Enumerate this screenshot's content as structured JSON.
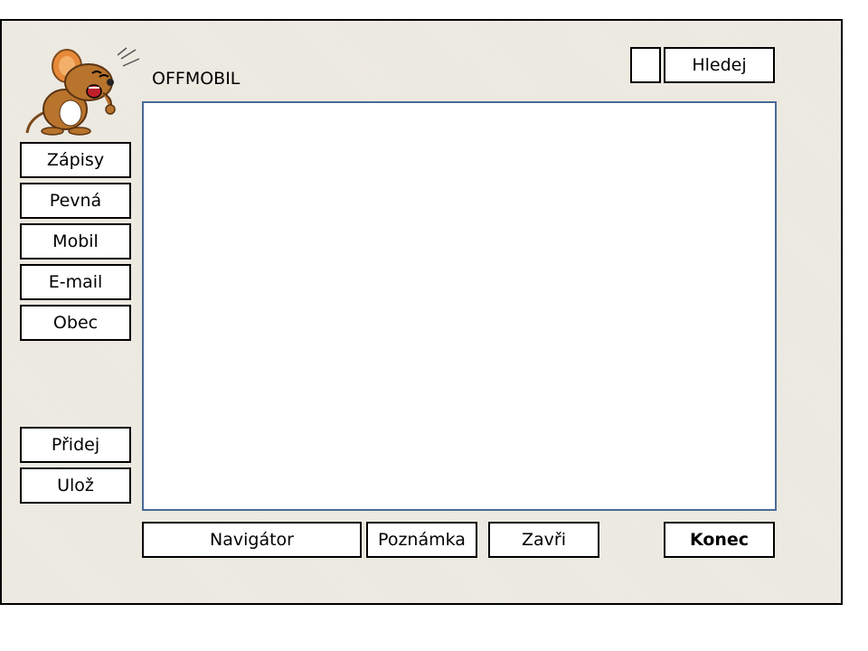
{
  "app": {
    "title": "OFFMOBIL",
    "logo_icon": "cartoon-mouse-icon"
  },
  "search": {
    "label": "Hledej"
  },
  "sidebar": {
    "items": [
      {
        "label": "Zápisy"
      },
      {
        "label": "Pevná"
      },
      {
        "label": "Mobil"
      },
      {
        "label": "E-mail"
      },
      {
        "label": "Obec"
      }
    ],
    "actions": [
      {
        "label": "Přidej"
      },
      {
        "label": "Ulož"
      }
    ]
  },
  "footer": {
    "navigator_label": "Navigátor",
    "note_label": "Poznámka",
    "close_label": "Zavři",
    "end_label": "Konec"
  },
  "colors": {
    "window_bg": "#eeebe3",
    "content_border": "#4a6a96",
    "mouse_body": "#b8732c",
    "mouse_ear": "#e88a3a"
  }
}
